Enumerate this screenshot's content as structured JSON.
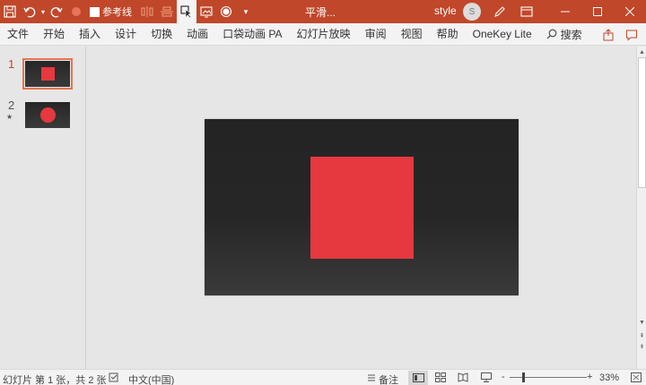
{
  "titlebar": {
    "qa_label": "参考线",
    "doc_title": "平滑...",
    "style_label": "style",
    "avatar_initial": "S",
    "accent_color": "#c0472a"
  },
  "ribbon": {
    "tabs": [
      "文件",
      "开始",
      "插入",
      "设计",
      "切换",
      "动画",
      "口袋动画 PA",
      "幻灯片放映",
      "审阅",
      "视图",
      "帮助",
      "OneKey Lite"
    ],
    "search_label": "搜索"
  },
  "thumbnails": [
    {
      "number": "1",
      "shape": "square",
      "selected": true
    },
    {
      "number": "2",
      "shape": "circle",
      "selected": false
    }
  ],
  "slide": {
    "shape": "square",
    "shape_color": "#e5383f",
    "background_color": "#262626"
  },
  "statusbar": {
    "slide_info": "幻灯片 第 1 张，共 2 张",
    "language": "中文(中国)",
    "notes_label": "备注",
    "zoom_minus": "-",
    "zoom_plus": "+",
    "zoom_level": "33%"
  }
}
